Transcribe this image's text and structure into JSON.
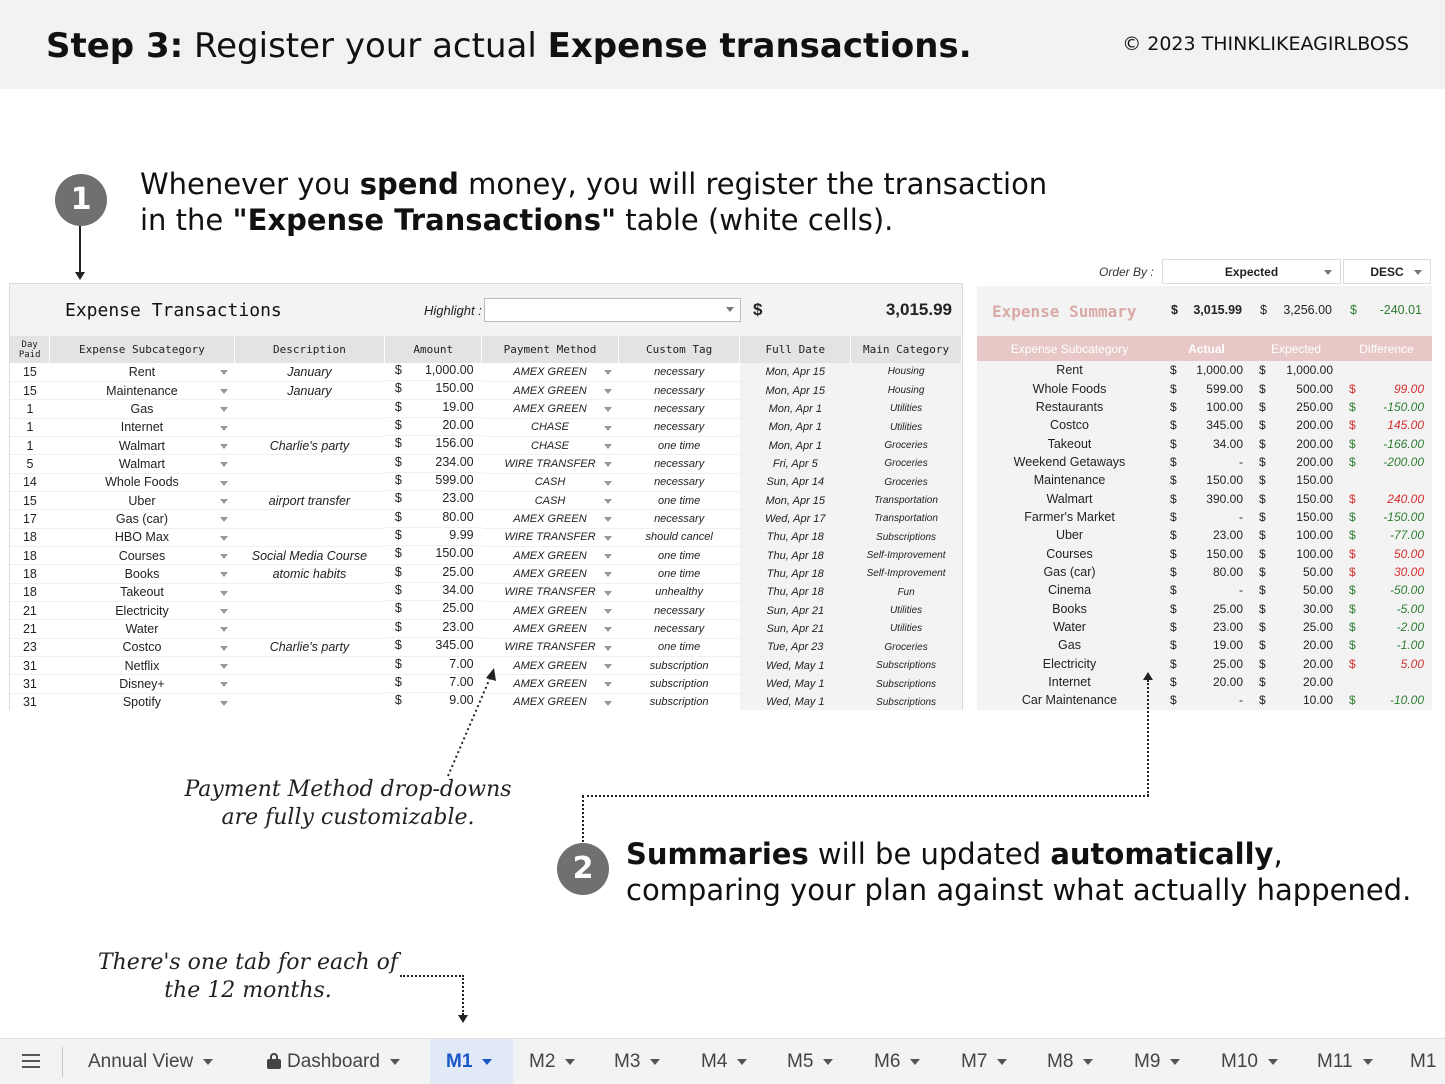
{
  "header": {
    "step_label": "Step 3:",
    "title_mid": " Register your actual ",
    "title_bold": "Expense transactions.",
    "copyright": "©  2023 THINKLIKEAGIRLBOSS"
  },
  "step1": {
    "number": "1",
    "line1_a": "Whenever you ",
    "line1_b": "spend",
    "line1_c": " money, you will register the transaction",
    "line2_a": "in the ",
    "line2_b": "\"Expense Transactions\"",
    "line2_c": " table (white cells)."
  },
  "step2": {
    "number": "2",
    "line1_a": "Summaries",
    "line1_b": " will be updated ",
    "line1_c": "automatically",
    "line1_d": ",",
    "line2": "comparing your plan against what actually happened."
  },
  "notes": {
    "payment": "Payment Method drop-downs are fully customizable.",
    "tabs": "There's one tab for each of the 12 months."
  },
  "transactions": {
    "title": "Expense Transactions",
    "highlight_label": "Highlight :",
    "highlight_value": "",
    "total_symbol": "$",
    "total": "3,015.99",
    "columns": [
      "Day Paid",
      "Expense Subcategory",
      "Description",
      "Amount",
      "Payment Method",
      "Custom Tag",
      "Full Date",
      "Main Category"
    ],
    "rows": [
      {
        "day": "15",
        "sub": "Rent",
        "desc": "January",
        "amt": "1,000.00",
        "pay": "AMEX GREEN",
        "tag": "necessary",
        "date": "Mon, Apr 15",
        "cat": "Housing"
      },
      {
        "day": "15",
        "sub": "Maintenance",
        "desc": "January",
        "amt": "150.00",
        "pay": "AMEX GREEN",
        "tag": "necessary",
        "date": "Mon, Apr 15",
        "cat": "Housing"
      },
      {
        "day": "1",
        "sub": "Gas",
        "desc": "",
        "amt": "19.00",
        "pay": "AMEX GREEN",
        "tag": "necessary",
        "date": "Mon, Apr 1",
        "cat": "Utilities"
      },
      {
        "day": "1",
        "sub": "Internet",
        "desc": "",
        "amt": "20.00",
        "pay": "CHASE",
        "tag": "necessary",
        "date": "Mon, Apr 1",
        "cat": "Utilities"
      },
      {
        "day": "1",
        "sub": "Walmart",
        "desc": "Charlie's party",
        "amt": "156.00",
        "pay": "CHASE",
        "tag": "one time",
        "date": "Mon, Apr 1",
        "cat": "Groceries"
      },
      {
        "day": "5",
        "sub": "Walmart",
        "desc": "",
        "amt": "234.00",
        "pay": "WIRE TRANSFER",
        "tag": "necessary",
        "date": "Fri, Apr 5",
        "cat": "Groceries"
      },
      {
        "day": "14",
        "sub": "Whole Foods",
        "desc": "",
        "amt": "599.00",
        "pay": "CASH",
        "tag": "necessary",
        "date": "Sun, Apr 14",
        "cat": "Groceries"
      },
      {
        "day": "15",
        "sub": "Uber",
        "desc": "airport transfer",
        "amt": "23.00",
        "pay": "CASH",
        "tag": "one time",
        "date": "Mon, Apr 15",
        "cat": "Transportation"
      },
      {
        "day": "17",
        "sub": "Gas (car)",
        "desc": "",
        "amt": "80.00",
        "pay": "AMEX GREEN",
        "tag": "necessary",
        "date": "Wed, Apr 17",
        "cat": "Transportation"
      },
      {
        "day": "18",
        "sub": "HBO Max",
        "desc": "",
        "amt": "9.99",
        "pay": "WIRE TRANSFER",
        "tag": "should cancel",
        "date": "Thu, Apr 18",
        "cat": "Subscriptions"
      },
      {
        "day": "18",
        "sub": "Courses",
        "desc": "Social Media Course",
        "amt": "150.00",
        "pay": "AMEX GREEN",
        "tag": "one time",
        "date": "Thu, Apr 18",
        "cat": "Self-Improvement"
      },
      {
        "day": "18",
        "sub": "Books",
        "desc": "atomic habits",
        "amt": "25.00",
        "pay": "AMEX GREEN",
        "tag": "one time",
        "date": "Thu, Apr 18",
        "cat": "Self-Improvement"
      },
      {
        "day": "18",
        "sub": "Takeout",
        "desc": "",
        "amt": "34.00",
        "pay": "WIRE TRANSFER",
        "tag": "unhealthy",
        "date": "Thu, Apr 18",
        "cat": "Fun"
      },
      {
        "day": "21",
        "sub": "Electricity",
        "desc": "",
        "amt": "25.00",
        "pay": "AMEX GREEN",
        "tag": "necessary",
        "date": "Sun, Apr 21",
        "cat": "Utilities"
      },
      {
        "day": "21",
        "sub": "Water",
        "desc": "",
        "amt": "23.00",
        "pay": "AMEX GREEN",
        "tag": "necessary",
        "date": "Sun, Apr 21",
        "cat": "Utilities"
      },
      {
        "day": "23",
        "sub": "Costco",
        "desc": "Charlie's party",
        "amt": "345.00",
        "pay": "WIRE TRANSFER",
        "tag": "one time",
        "date": "Tue, Apr 23",
        "cat": "Groceries"
      },
      {
        "day": "31",
        "sub": "Netflix",
        "desc": "",
        "amt": "7.00",
        "pay": "AMEX GREEN",
        "tag": "subscription",
        "date": "Wed, May 1",
        "cat": "Subscriptions"
      },
      {
        "day": "31",
        "sub": "Disney+",
        "desc": "",
        "amt": "7.00",
        "pay": "AMEX GREEN",
        "tag": "subscription",
        "date": "Wed, May 1",
        "cat": "Subscriptions"
      },
      {
        "day": "31",
        "sub": "Spotify",
        "desc": "",
        "amt": "9.00",
        "pay": "AMEX GREEN",
        "tag": "subscription",
        "date": "Wed, May 1",
        "cat": "Subscriptions"
      }
    ]
  },
  "summary": {
    "order_by_label": "Order By :",
    "order_by_value": "Expected",
    "order_dir": "DESC",
    "title": "Expense Summary",
    "total_actual": "3,015.99",
    "total_expected": "3,256.00",
    "total_diff": "-240.01",
    "columns": [
      "Expense Subcategory",
      "Actual",
      "Expected",
      "Difference"
    ],
    "rows": [
      {
        "name": "Rent",
        "actual": "1,000.00",
        "expected": "1,000.00",
        "diff": "",
        "state": ""
      },
      {
        "name": "Whole Foods",
        "actual": "599.00",
        "expected": "500.00",
        "diff": "99.00",
        "state": "neg"
      },
      {
        "name": "Restaurants",
        "actual": "100.00",
        "expected": "250.00",
        "diff": "-150.00",
        "state": "pos"
      },
      {
        "name": "Costco",
        "actual": "345.00",
        "expected": "200.00",
        "diff": "145.00",
        "state": "neg"
      },
      {
        "name": "Takeout",
        "actual": "34.00",
        "expected": "200.00",
        "diff": "-166.00",
        "state": "pos"
      },
      {
        "name": "Weekend Getaways",
        "actual": "-",
        "expected": "200.00",
        "diff": "-200.00",
        "state": "pos"
      },
      {
        "name": "Maintenance",
        "actual": "150.00",
        "expected": "150.00",
        "diff": "",
        "state": ""
      },
      {
        "name": "Walmart",
        "actual": "390.00",
        "expected": "150.00",
        "diff": "240.00",
        "state": "neg"
      },
      {
        "name": "Farmer's Market",
        "actual": "-",
        "expected": "150.00",
        "diff": "-150.00",
        "state": "pos"
      },
      {
        "name": "Uber",
        "actual": "23.00",
        "expected": "100.00",
        "diff": "-77.00",
        "state": "pos"
      },
      {
        "name": "Courses",
        "actual": "150.00",
        "expected": "100.00",
        "diff": "50.00",
        "state": "neg"
      },
      {
        "name": "Gas (car)",
        "actual": "80.00",
        "expected": "50.00",
        "diff": "30.00",
        "state": "neg"
      },
      {
        "name": "Cinema",
        "actual": "-",
        "expected": "50.00",
        "diff": "-50.00",
        "state": "pos"
      },
      {
        "name": "Books",
        "actual": "25.00",
        "expected": "30.00",
        "diff": "-5.00",
        "state": "pos"
      },
      {
        "name": "Water",
        "actual": "23.00",
        "expected": "25.00",
        "diff": "-2.00",
        "state": "pos"
      },
      {
        "name": "Gas",
        "actual": "19.00",
        "expected": "20.00",
        "diff": "-1.00",
        "state": "pos"
      },
      {
        "name": "Electricity",
        "actual": "25.00",
        "expected": "20.00",
        "diff": "5.00",
        "state": "neg"
      },
      {
        "name": "Internet",
        "actual": "20.00",
        "expected": "20.00",
        "diff": "",
        "state": ""
      },
      {
        "name": "Car Maintenance",
        "actual": "-",
        "expected": "10.00",
        "diff": "-10.00",
        "state": "pos"
      }
    ]
  },
  "tabs": [
    {
      "label": "Annual View",
      "locked": false,
      "active": false
    },
    {
      "label": "Dashboard",
      "locked": true,
      "active": false
    },
    {
      "label": "M1",
      "locked": false,
      "active": true
    },
    {
      "label": "M2",
      "locked": false,
      "active": false
    },
    {
      "label": "M3",
      "locked": false,
      "active": false
    },
    {
      "label": "M4",
      "locked": false,
      "active": false
    },
    {
      "label": "M5",
      "locked": false,
      "active": false
    },
    {
      "label": "M6",
      "locked": false,
      "active": false
    },
    {
      "label": "M7",
      "locked": false,
      "active": false
    },
    {
      "label": "M8",
      "locked": false,
      "active": false
    },
    {
      "label": "M9",
      "locked": false,
      "active": false
    },
    {
      "label": "M10",
      "locked": false,
      "active": false
    },
    {
      "label": "M11",
      "locked": false,
      "active": false
    },
    {
      "label": "M1",
      "locked": false,
      "active": false
    }
  ],
  "colors": {
    "positive": "#2e7d32",
    "negative": "#d32f2f",
    "summary_header": "#e7c8c6",
    "active_tab": "#1a56c9"
  }
}
